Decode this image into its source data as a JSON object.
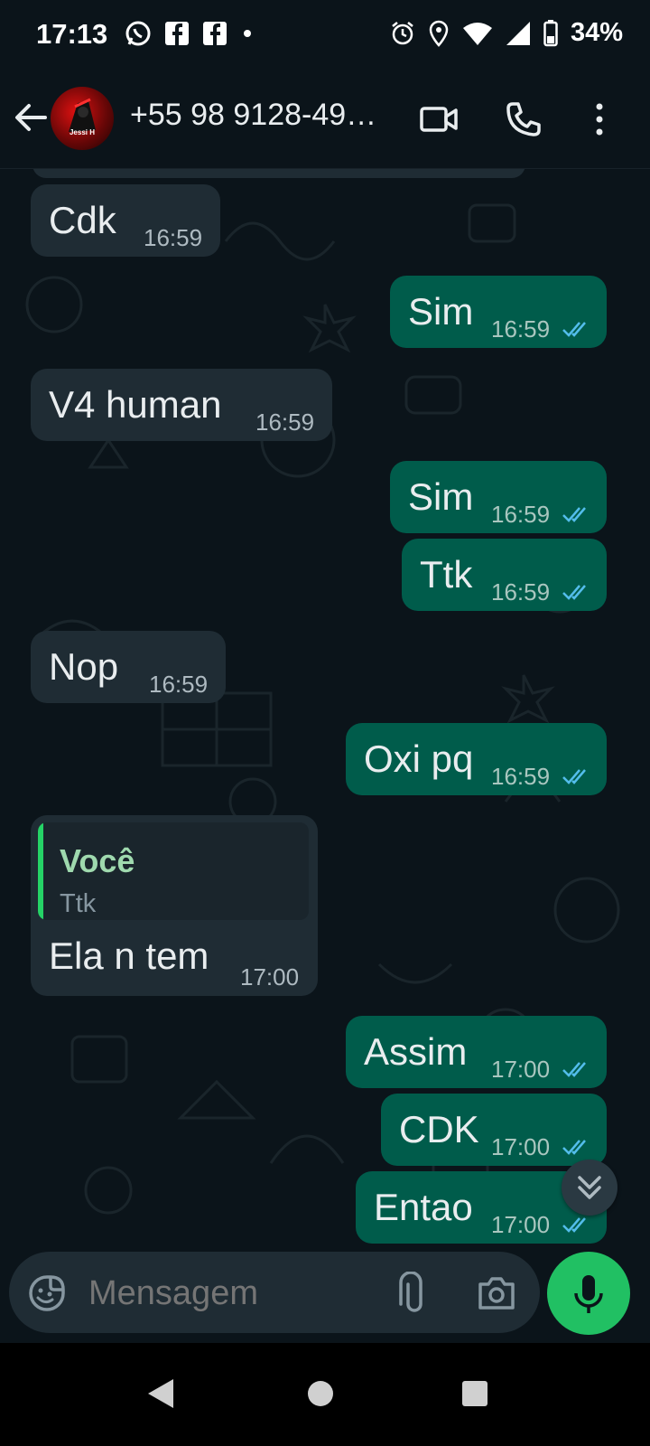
{
  "status_bar": {
    "time": "17:13",
    "battery": "34%",
    "left_icons": [
      "whatsapp-icon",
      "facebook-icon",
      "facebook-icon",
      "dot-icon"
    ],
    "right_icons": [
      "alarm-icon",
      "location-icon",
      "wifi-icon",
      "signal-icon",
      "battery-icon"
    ]
  },
  "header": {
    "contact_name": "+55 98 9128-49…",
    "avatar_label": "Jessi H"
  },
  "messages": [
    {
      "dir": "in",
      "text": "Cdk",
      "time": "16:59"
    },
    {
      "dir": "out",
      "text": "Sim",
      "time": "16:59",
      "status": "read"
    },
    {
      "dir": "in",
      "text": "V4 human",
      "time": "16:59"
    },
    {
      "dir": "out",
      "text": "Sim",
      "time": "16:59",
      "status": "read"
    },
    {
      "dir": "out",
      "text": "Ttk",
      "time": "16:59",
      "status": "read"
    },
    {
      "dir": "in",
      "text": "Nop",
      "time": "16:59"
    },
    {
      "dir": "out",
      "text": "Oxi pq",
      "time": "16:59",
      "status": "read"
    },
    {
      "dir": "in",
      "text": "Ela n tem",
      "time": "17:00",
      "quote": {
        "author": "Você",
        "text": "Ttk"
      }
    },
    {
      "dir": "out",
      "text": "Assim",
      "time": "17:00",
      "status": "read"
    },
    {
      "dir": "out",
      "text": "CDK",
      "time": "17:00",
      "status": "read"
    },
    {
      "dir": "out",
      "text": "Entao",
      "time": "17:00",
      "status": "read"
    }
  ],
  "composer": {
    "placeholder": "Mensagem"
  },
  "colors": {
    "background": "#0b141a",
    "incoming_bubble": "#1f2c34",
    "outgoing_bubble": "#005c4b",
    "accent_green": "#21c063",
    "read_ticks": "#53bdeb"
  }
}
